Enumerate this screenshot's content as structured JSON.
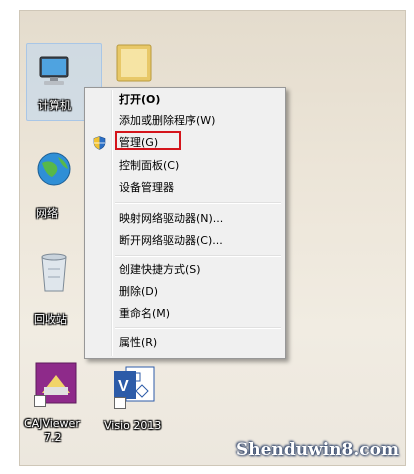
{
  "desktop": {
    "icons": {
      "computer": {
        "label": "计算机"
      },
      "folder": {
        "label": ""
      },
      "network": {
        "label": "网络"
      },
      "recycle_bin": {
        "label": "回收站"
      },
      "cajviewer": {
        "label_line1": "CAJViewer",
        "label_line2": "7.2"
      },
      "visio": {
        "label": "Visio 2013"
      }
    }
  },
  "context_menu": {
    "items": [
      {
        "label": "打开(O)"
      },
      {
        "label": "添加或删除程序(W)"
      },
      {
        "label": "管理(G)"
      },
      {
        "label": "控制面板(C)"
      },
      {
        "label": "设备管理器"
      },
      {
        "label": "映射网络驱动器(N)..."
      },
      {
        "label": "断开网络驱动器(C)..."
      },
      {
        "label": "创建快捷方式(S)"
      },
      {
        "label": "删除(D)"
      },
      {
        "label": "重命名(M)"
      },
      {
        "label": "属性(R)"
      }
    ]
  },
  "watermark": "Shenduwin8.com",
  "colors": {
    "highlight": "#d4141b",
    "menu_bg": "#f0f0f0"
  }
}
